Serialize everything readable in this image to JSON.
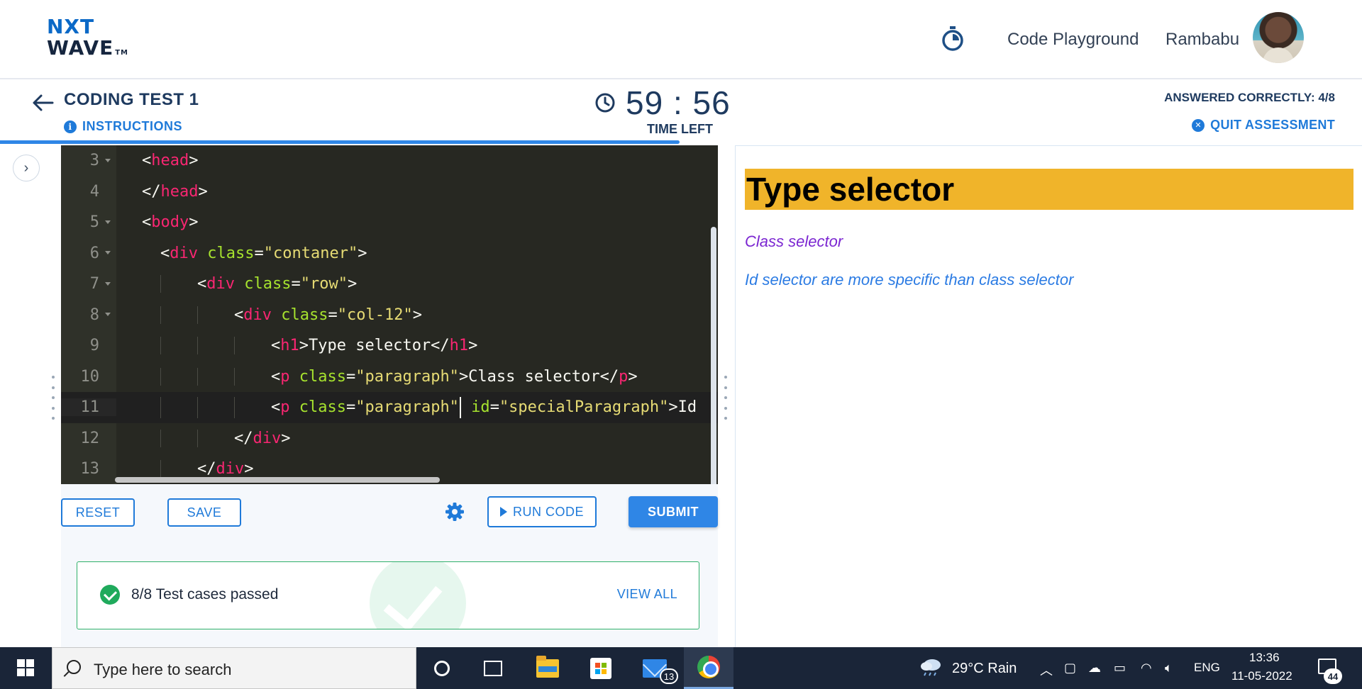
{
  "header": {
    "logo_line1": "NXT",
    "logo_line2": "WAVE",
    "logo_tm": "TM",
    "nav_link": "Code Playground",
    "username": "Rambabu"
  },
  "test": {
    "title": "CODING TEST 1",
    "instructions": "INSTRUCTIONS",
    "timer": "59 : 56",
    "time_left_label": "TIME LEFT",
    "answered": "ANSWERED CORRECTLY: 4/8",
    "quit": "QUIT ASSESSMENT",
    "progress_fraction": 0.5
  },
  "editor": {
    "lines": [
      {
        "n": "3",
        "fold": true
      },
      {
        "n": "4",
        "fold": false
      },
      {
        "n": "5",
        "fold": true
      },
      {
        "n": "6",
        "fold": true
      },
      {
        "n": "7",
        "fold": true
      },
      {
        "n": "8",
        "fold": true
      },
      {
        "n": "9",
        "fold": false
      },
      {
        "n": "10",
        "fold": false
      },
      {
        "n": "11",
        "fold": false
      },
      {
        "n": "12",
        "fold": false
      },
      {
        "n": "13",
        "fold": false
      }
    ],
    "active_line": "11"
  },
  "buttons": {
    "reset": "RESET",
    "save": "SAVE",
    "run_code": "RUN CODE",
    "submit": "SUBMIT"
  },
  "result": {
    "text": "8/8 Test cases passed",
    "view_all": "VIEW ALL"
  },
  "preview": {
    "heading": "Type selector",
    "paragraph1": "Class selector",
    "paragraph2": "Id selector are more specific than class selector",
    "heading_bg": "#f0b42a",
    "paragraph1_color": "#7b26d1",
    "paragraph2_color": "#2b7be3"
  },
  "taskbar": {
    "search_placeholder": "Type here to search",
    "mail_badge": "13",
    "weather": "29°C  Rain",
    "language": "ENG",
    "time": "13:36",
    "date": "11-05-2022",
    "notifications": "44"
  }
}
